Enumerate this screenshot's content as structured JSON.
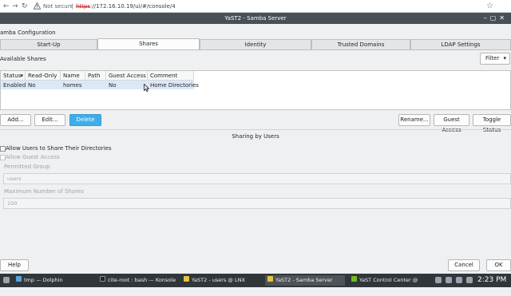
{
  "browser": {
    "back_glyph": "←",
    "forward_glyph": "→",
    "reload_glyph": "↻",
    "warn_icon": "warning-triangle-icon",
    "security_text": "Not secure",
    "separator": "|",
    "url_scheme": "https",
    "url_rest": "://172.16.10.19/ui/#/console/4",
    "star_glyph": "☆"
  },
  "window": {
    "title": "YaST2 - Samba Server",
    "controls": "–▢✕"
  },
  "dialog": {
    "heading": "amba Configuration",
    "tabs": [
      "Start-Up",
      "Shares",
      "Identity",
      "Trusted Domains",
      "LDAP Settings"
    ],
    "active_tab": "Shares"
  },
  "shares": {
    "title": "Available Shares",
    "filter_label": "Filter",
    "filter_glyph": "▾",
    "columns": [
      "Status",
      "Read-Only",
      "Name",
      "Path",
      "Guest Access",
      "Comment"
    ],
    "status_sort_glyph": "▾",
    "rows": [
      {
        "status": "Enabled",
        "read_only": "No",
        "name": "homes",
        "path": "",
        "guest_access": "No",
        "comment": "Home Directories"
      }
    ]
  },
  "buttons": {
    "add": "Add...",
    "edit": "Edit...",
    "delete": "Delete",
    "rename": "Rename...",
    "guest_access": "Guest Access",
    "toggle_status": "Toggle Status"
  },
  "sharing_by_users": {
    "title": "Sharing by Users",
    "allow_users_label": "Allow Users to Share Their Directories",
    "allow_guest_label": "Allow Guest Access",
    "permitted_group_label": "Permitted Group",
    "permitted_group_value": "users",
    "max_shares_label": "Maximum Number of Shares",
    "max_shares_value": "100"
  },
  "footer": {
    "help": "Help",
    "cancel": "Cancel",
    "ok": "OK"
  },
  "taskbar": {
    "tasks": [
      "tmp — Dolphin",
      "cite-root : bash — Konsole",
      "YaST2 - users @ LNX",
      "YaST2 - Samba Server",
      "YaST Control Center @ LNX"
    ],
    "clock": "2:23 PM"
  },
  "colors": {
    "accent": "#3daee9",
    "titlebar": "#475057",
    "taskbar": "#31363b",
    "selection": "#dce8f7",
    "warning": "#c5221f"
  }
}
